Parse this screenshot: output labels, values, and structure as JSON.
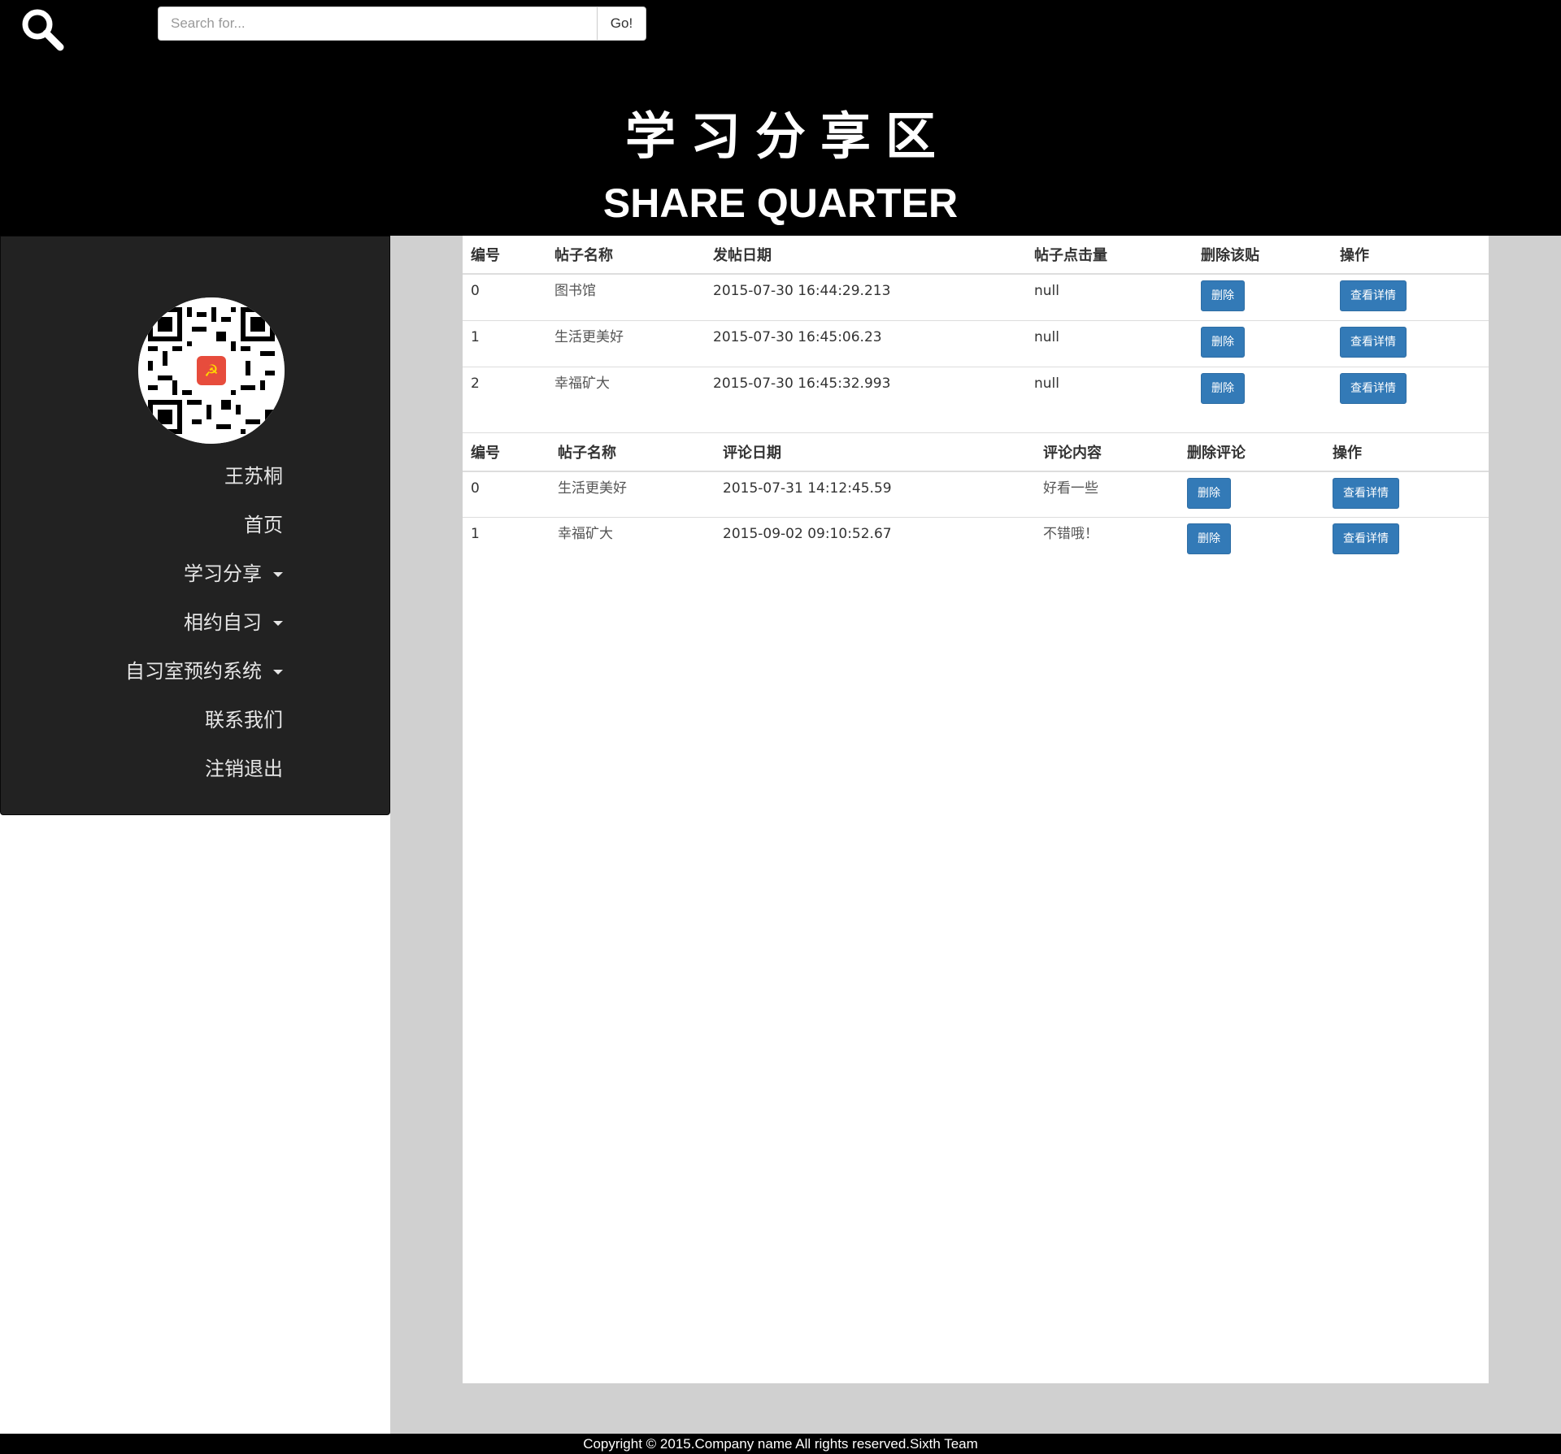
{
  "search": {
    "placeholder": "Search for...",
    "go_label": "Go!"
  },
  "header": {
    "title_cn": "学习分享区",
    "title_en": "SHARE QUARTER"
  },
  "sidebar": {
    "items": [
      {
        "label": "王苏桐"
      },
      {
        "label": "首页"
      },
      {
        "label": "学习分享"
      },
      {
        "label": "相约自习"
      },
      {
        "label": "自习室预约系统"
      },
      {
        "label": "联系我们"
      },
      {
        "label": "注销退出"
      }
    ]
  },
  "posts_table": {
    "headers": [
      "编号",
      "帖子名称",
      "发帖日期",
      "帖子点击量",
      "删除该贴",
      "操作"
    ],
    "rows": [
      {
        "id": "0",
        "name": "图书馆",
        "date": "2015-07-30 16:44:29.213",
        "clicks": "null",
        "delete": "删除",
        "details": "查看详情"
      },
      {
        "id": "1",
        "name": "生活更美好",
        "date": "2015-07-30 16:45:06.23",
        "clicks": "null",
        "delete": "删除",
        "details": "查看详情"
      },
      {
        "id": "2",
        "name": "幸福矿大",
        "date": "2015-07-30 16:45:32.993",
        "clicks": "null",
        "delete": "删除",
        "details": "查看详情"
      }
    ]
  },
  "comments_table": {
    "headers": [
      "编号",
      "帖子名称",
      "评论日期",
      "评论内容",
      "删除评论",
      "操作"
    ],
    "rows": [
      {
        "id": "0",
        "name": "生活更美好",
        "date": "2015-07-31 14:12:45.59",
        "content": "好看一些",
        "delete": "删除",
        "details": "查看详情"
      },
      {
        "id": "1",
        "name": "幸福矿大",
        "date": "2015-09-02 09:10:52.67",
        "content": "不错哦！",
        "delete": "删除",
        "details": "查看详情"
      }
    ]
  },
  "footer": {
    "text": "Copyright © 2015.Company name All rights reserved.Sixth Team"
  },
  "colors": {
    "header_bg": "#000000",
    "sidebar_bg": "#222222",
    "content_bg": "#d0d0d0",
    "button_primary": "#337ab7"
  }
}
